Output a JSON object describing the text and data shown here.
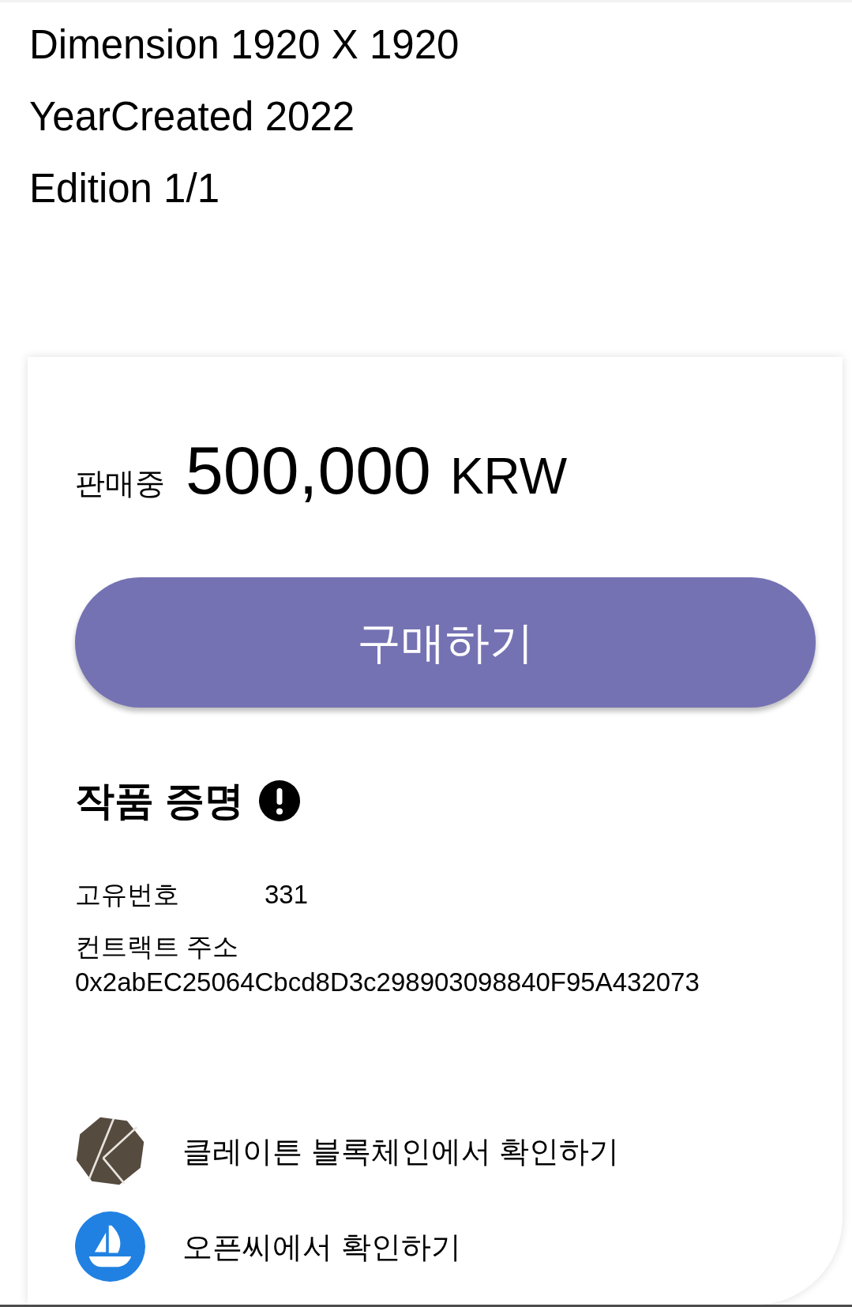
{
  "details": [
    "Dimension 1920 X 1920",
    "YearCreated 2022",
    "Edition 1/1"
  ],
  "sale": {
    "status": "판매중",
    "price": "500,000",
    "currency": "KRW"
  },
  "buy_button": "구매하기",
  "certificate": {
    "title": "작품 증명",
    "fields": [
      {
        "kind": "inline",
        "label": "고유번호",
        "value": "331"
      },
      {
        "kind": "stacked",
        "label": "컨트랙트 주소",
        "value": "0x2abEC25064Cbcd8D3c298903098840F95A432073"
      }
    ]
  },
  "links": [
    {
      "kind": "blockchain",
      "label": "클레이튼 블록체인에서 확인하기"
    },
    {
      "kind": "marketplace",
      "label": "오픈씨에서 확인하기"
    }
  ]
}
